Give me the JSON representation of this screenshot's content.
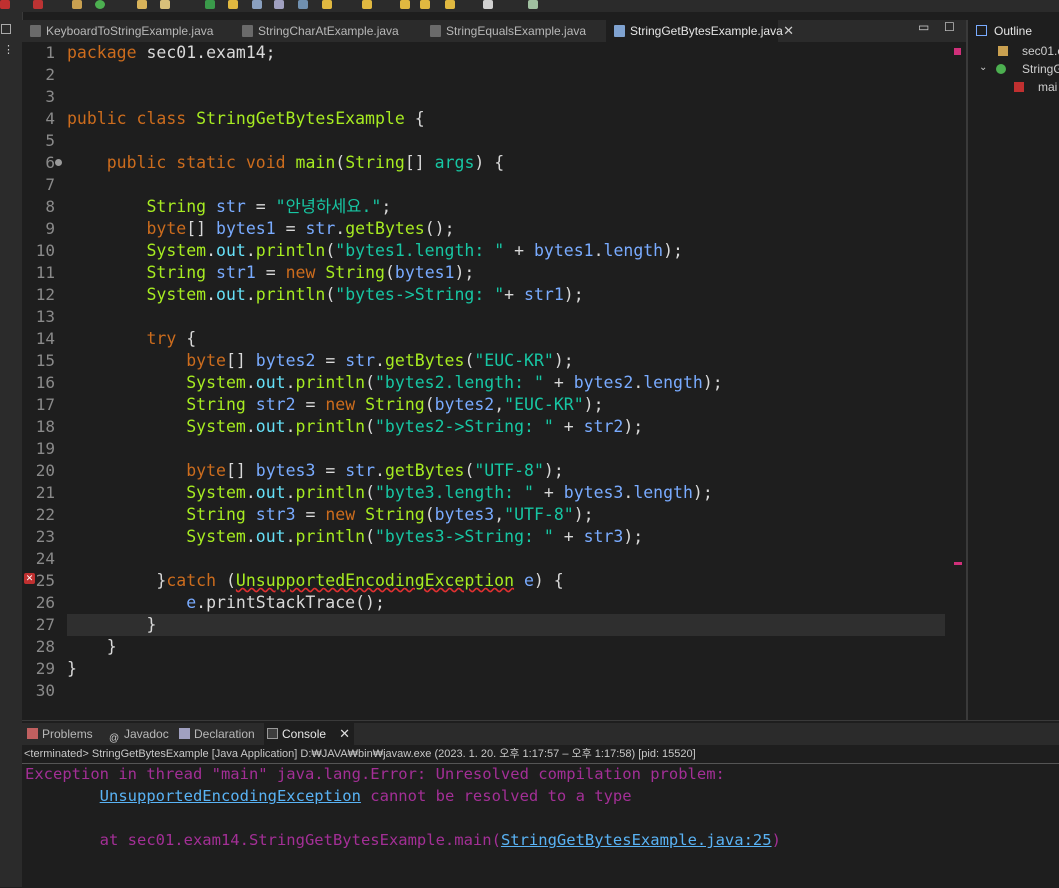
{
  "editor_tabs": [
    {
      "label": "KeyboardToStringExample.java",
      "active": false
    },
    {
      "label": "StringCharAtExample.java",
      "active": false
    },
    {
      "label": "StringEqualsExample.java",
      "active": false
    },
    {
      "label": "StringGetBytesExample.java",
      "active": true
    }
  ],
  "code": {
    "l1": "package sec01.exam14;",
    "l4_kw1": "public",
    "l4_kw2": "class",
    "l4_name": "StringGetBytesExample",
    "l4_brace": " {",
    "l6_kw1": "public",
    "l6_kw2": "static",
    "l6_kw3": "void",
    "l6_method": "main",
    "l6_type": "String",
    "l6_arr": "[] ",
    "l6_param": "args",
    "l6_tail": ") {",
    "l8_type": "String",
    "l8_var": "str",
    "l8_eq": " = ",
    "l8_str": "\"안녕하세요.\"",
    "l8_end": ";",
    "l9_kw": "byte",
    "l9_a": "[] ",
    "l9_var": "bytes1",
    "l9_eq": " = ",
    "l9_obj": "str",
    "l9_dot": ".",
    "l9_m": "getBytes",
    "l9_end": "();",
    "l10_cls": "System",
    "l10_fld": "out",
    "l10_m": "println",
    "l10_str": "\"bytes1.length: \"",
    "l10_plus": " + ",
    "l10_var": "bytes1",
    "l10_fld2": "length",
    "l10_end": ");",
    "l11_type": "String",
    "l11_var": "str1",
    "l11_eq": " = ",
    "l11_new": "new",
    "l11_type2": "String",
    "l11_arg": "bytes1",
    "l11_end": ");",
    "l12_cls": "System",
    "l12_fld": "out",
    "l12_m": "println",
    "l12_str": "\"bytes->String: \"",
    "l12_plus": "+ ",
    "l12_var": "str1",
    "l12_end": ");",
    "l14_kw": "try",
    "l14_b": " {",
    "l15_kw": "byte",
    "l15_a": "[] ",
    "l15_var": "bytes2",
    "l15_eq": " = ",
    "l15_obj": "str",
    "l15_m": "getBytes",
    "l15_str": "\"EUC-KR\"",
    "l15_end": ");",
    "l16_cls": "System",
    "l16_fld": "out",
    "l16_m": "println",
    "l16_str": "\"bytes2.length: \"",
    "l16_plus": " + ",
    "l16_var": "bytes2",
    "l16_fld2": "length",
    "l16_end": ");",
    "l17_type": "String",
    "l17_var": "str2",
    "l17_eq": " = ",
    "l17_new": "new",
    "l17_type2": "String",
    "l17_arg": "bytes2",
    "l17_str": "\"EUC-KR\"",
    "l17_end": ");",
    "l18_cls": "System",
    "l18_fld": "out",
    "l18_m": "println",
    "l18_str": "\"bytes2->String: \"",
    "l18_plus": " + ",
    "l18_var": "str2",
    "l18_end": ");",
    "l20_kw": "byte",
    "l20_a": "[] ",
    "l20_var": "bytes3",
    "l20_eq": " = ",
    "l20_obj": "str",
    "l20_m": "getBytes",
    "l20_str": "\"UTF-8\"",
    "l20_end": ");",
    "l21_cls": "System",
    "l21_fld": "out",
    "l21_m": "println",
    "l21_str": "\"byte3.length: \"",
    "l21_plus": " + ",
    "l21_var": "bytes3",
    "l21_fld2": "length",
    "l21_end": ");",
    "l22_type": "String",
    "l22_var": "str3",
    "l22_eq": " = ",
    "l22_new": "new",
    "l22_type2": "String",
    "l22_arg": "bytes3",
    "l22_str": "\"UTF-8\"",
    "l22_end": ");",
    "l23_cls": "System",
    "l23_fld": "out",
    "l23_m": "println",
    "l23_str": "\"bytes3->String: \"",
    "l23_plus": " + ",
    "l23_var": "str3",
    "l23_end": ");",
    "l25_pre": "}",
    "l25_kw": "catch",
    "l25_open": " (",
    "l25_type": "UnsupportedEncodingException",
    "l25_sp": " ",
    "l25_var": "e",
    "l25_close": ") {",
    "l26_var": "e",
    "l26_rest": ".printStackTrace();",
    "l27": "}",
    "l28": "}",
    "l29": "}"
  },
  "line_numbers": [
    "1",
    "2",
    "3",
    "4",
    "5",
    "6",
    "7",
    "8",
    "9",
    "10",
    "11",
    "12",
    "13",
    "14",
    "15",
    "16",
    "17",
    "18",
    "19",
    "20",
    "21",
    "22",
    "23",
    "24",
    "25",
    "26",
    "27",
    "28",
    "29",
    "30"
  ],
  "outline": {
    "tab_label": "Outline",
    "items": [
      "sec01.e",
      "StringG",
      "mai"
    ]
  },
  "bottom_tabs": [
    {
      "label": "Problems",
      "active": false
    },
    {
      "label": "Javadoc",
      "active": false
    },
    {
      "label": "Declaration",
      "active": false
    },
    {
      "label": "Console",
      "active": true
    }
  ],
  "console": {
    "status": "<terminated> StringGetBytesExample [Java Application] D:₩JAVA₩bin₩javaw.exe  (2023. 1. 20. 오후 1:17:57 – 오후 1:17:58) [pid: 15520]",
    "line1": "Exception in thread \"main\" java.lang.Error: Unresolved compilation problem: ",
    "line2_link": "UnsupportedEncodingException",
    "line2_rest": " cannot be resolved to a type",
    "line3_pre": "at sec01.exam14.StringGetBytesExample.main(",
    "line3_link": "StringGetBytesExample.java:25",
    "line3_post": ")"
  },
  "colors": {
    "keyword": "#cc6c1d",
    "type": "#1290c3",
    "string": "#17c6a3",
    "method": "#a7ec21",
    "console_error": "#a32f96",
    "link": "#59b3f5"
  }
}
